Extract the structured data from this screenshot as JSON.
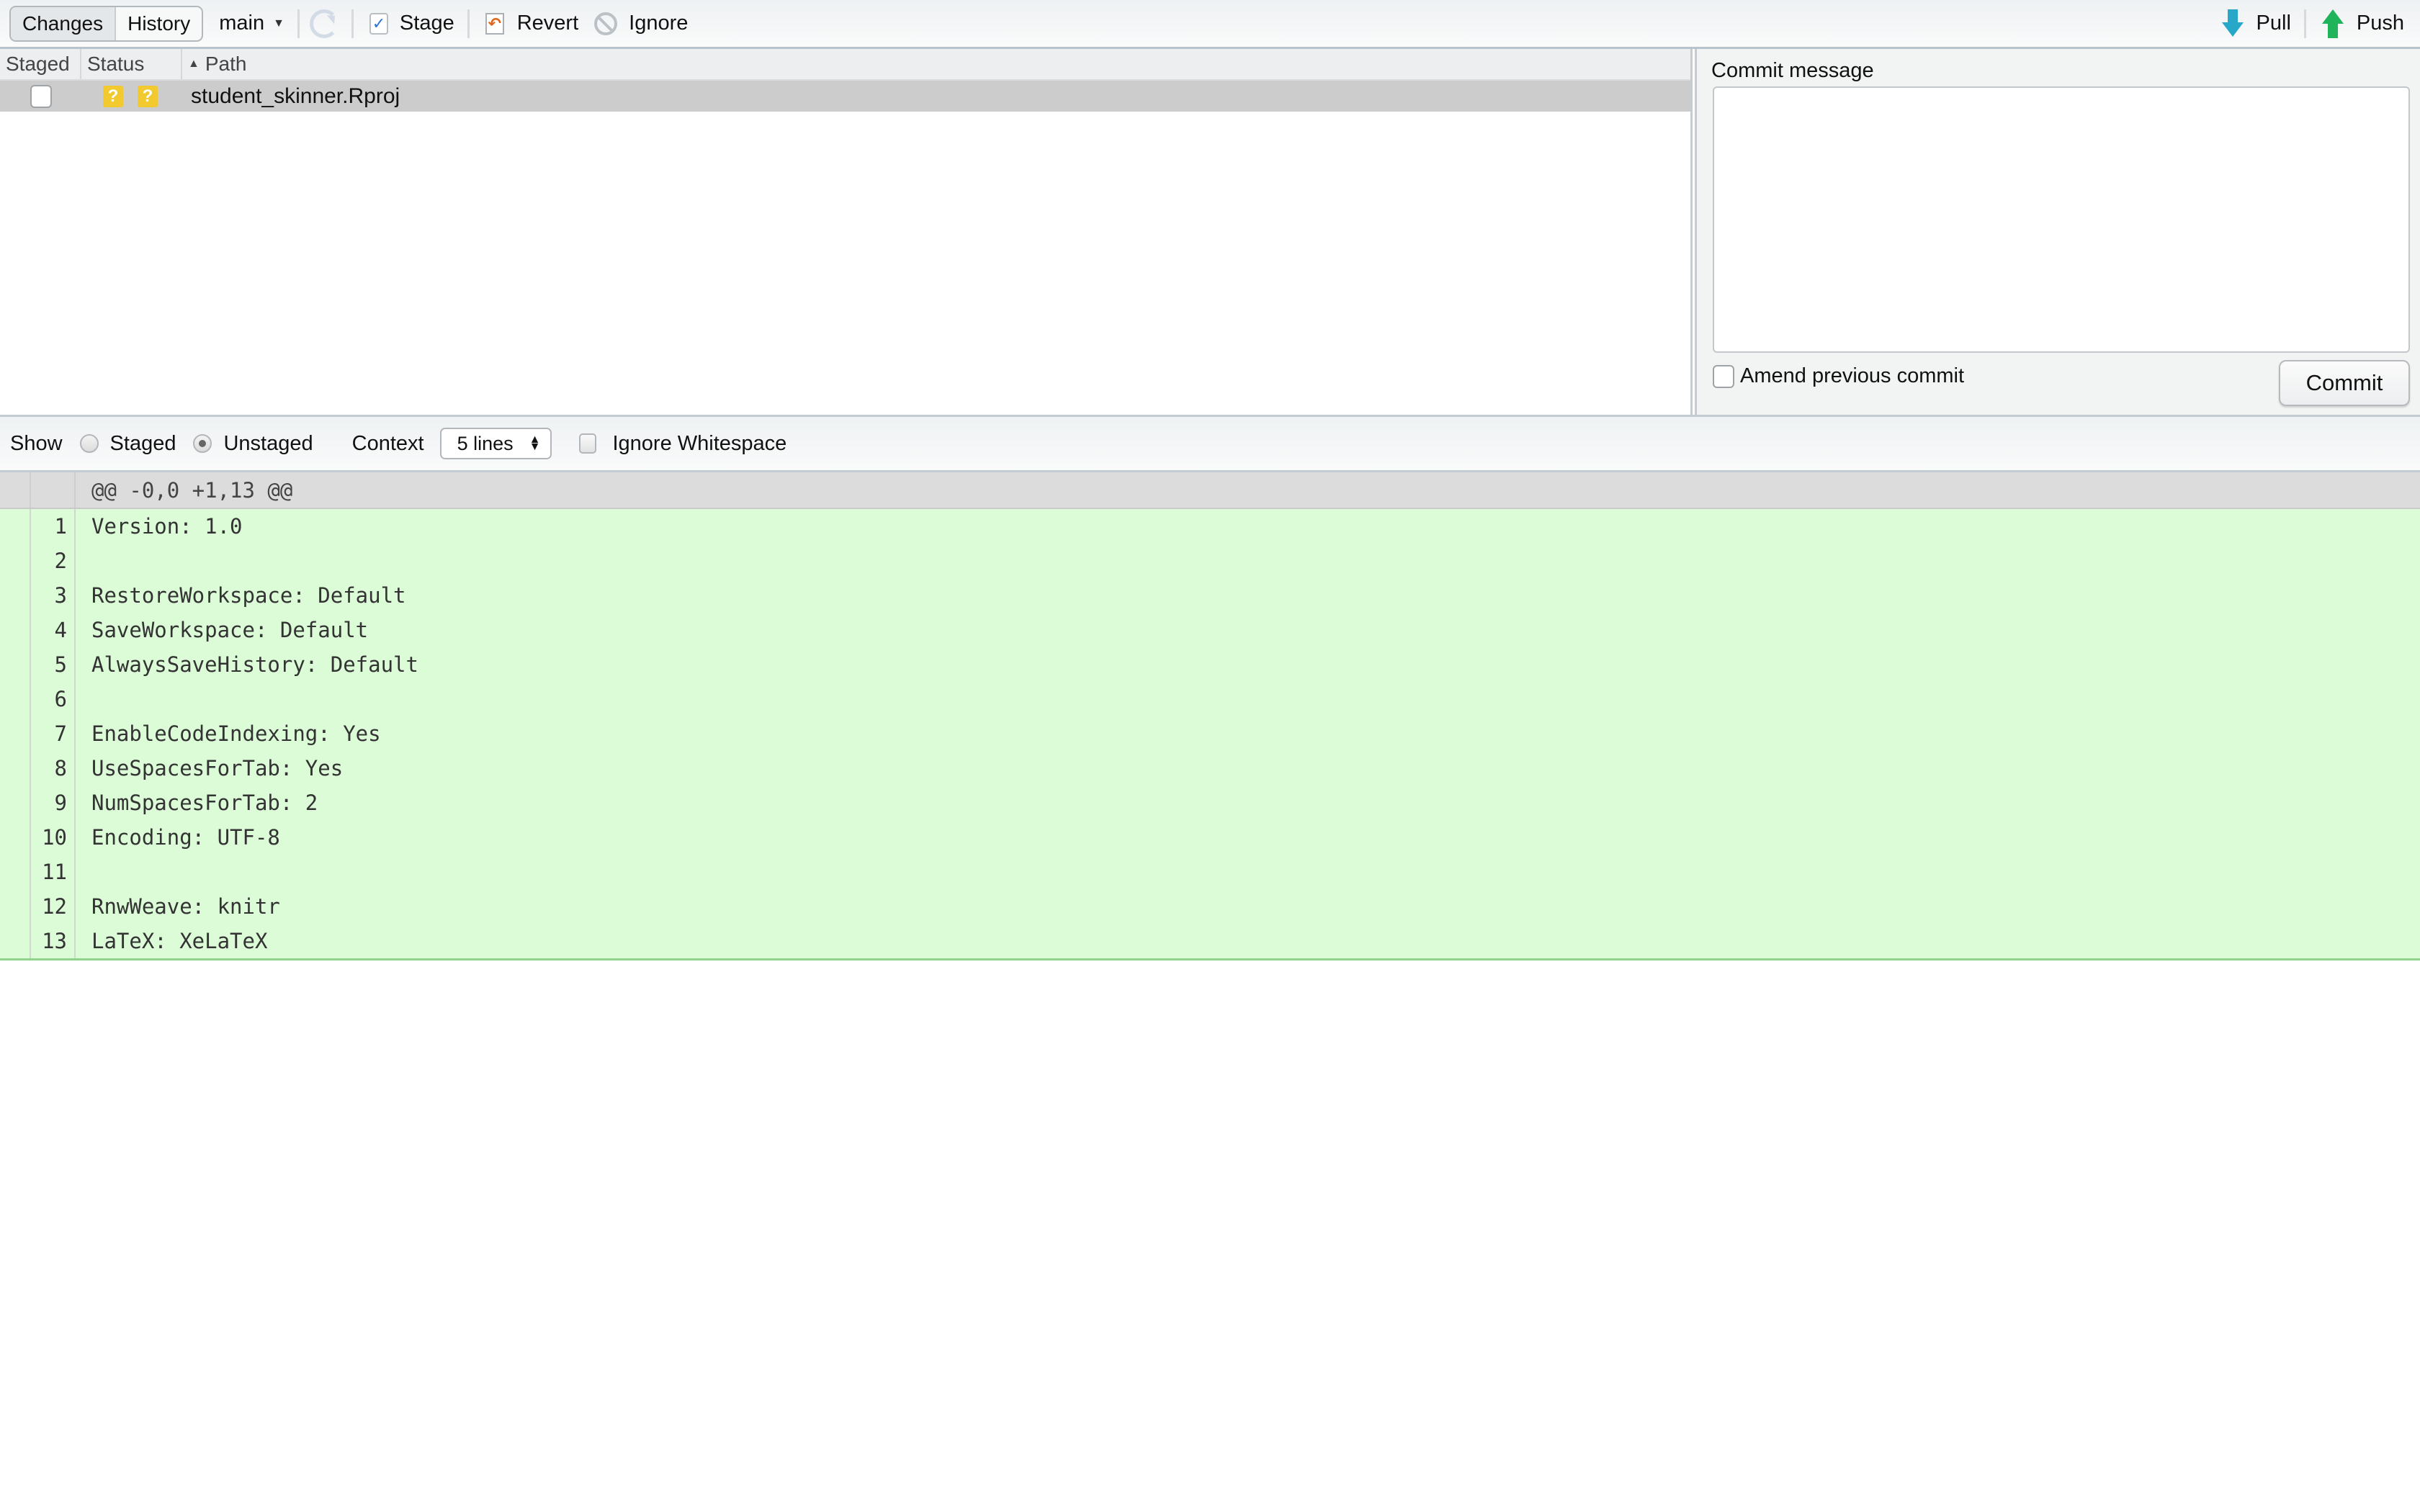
{
  "toolbar": {
    "tabs": [
      {
        "label": "Changes",
        "active": true
      },
      {
        "label": "History",
        "active": false
      }
    ],
    "branch": "main",
    "stage_label": "Stage",
    "revert_label": "Revert",
    "ignore_label": "Ignore",
    "pull_label": "Pull",
    "push_label": "Push",
    "icons": {
      "refresh": "refresh-icon",
      "stage": "checkbox-check-icon",
      "revert": "revert-arrow-icon",
      "ignore": "prohibited-icon",
      "pull": "arrow-down-icon",
      "push": "arrow-up-icon"
    },
    "colors": {
      "pull": "#27a8c9",
      "push": "#20b45a",
      "revert": "#e0651a",
      "stage": "#2a74d9"
    }
  },
  "file_list": {
    "columns": [
      "Staged",
      "Status",
      "Path"
    ],
    "sort_column": "Path",
    "sort_direction": "ascending",
    "rows": [
      {
        "staged": false,
        "status": [
          "?",
          "?"
        ],
        "path": "student_skinner.Rproj",
        "selected": true
      }
    ],
    "status_color": "#f2c92f"
  },
  "commit_panel": {
    "label": "Commit message",
    "message": "",
    "amend_label": "Amend previous commit",
    "amend_checked": false,
    "commit_button": "Commit"
  },
  "diff_toolbar": {
    "show_label": "Show",
    "options": [
      {
        "label": "Staged",
        "selected": false
      },
      {
        "label": "Unstaged",
        "selected": true
      }
    ],
    "context_label": "Context",
    "context_value": "5 lines",
    "ignore_whitespace_label": "Ignore Whitespace",
    "ignore_whitespace_checked": false
  },
  "diff": {
    "hunk_header": "@@ -0,0 +1,13 @@",
    "added_color": "#dcfcd8",
    "lines": [
      {
        "num": "1",
        "text": "Version: 1.0"
      },
      {
        "num": "2",
        "text": ""
      },
      {
        "num": "3",
        "text": "RestoreWorkspace: Default"
      },
      {
        "num": "4",
        "text": "SaveWorkspace: Default"
      },
      {
        "num": "5",
        "text": "AlwaysSaveHistory: Default"
      },
      {
        "num": "6",
        "text": ""
      },
      {
        "num": "7",
        "text": "EnableCodeIndexing: Yes"
      },
      {
        "num": "8",
        "text": "UseSpacesForTab: Yes"
      },
      {
        "num": "9",
        "text": "NumSpacesForTab: 2"
      },
      {
        "num": "10",
        "text": "Encoding: UTF-8"
      },
      {
        "num": "11",
        "text": ""
      },
      {
        "num": "12",
        "text": "RnwWeave: knitr"
      },
      {
        "num": "13",
        "text": "LaTeX: XeLaTeX"
      }
    ]
  }
}
